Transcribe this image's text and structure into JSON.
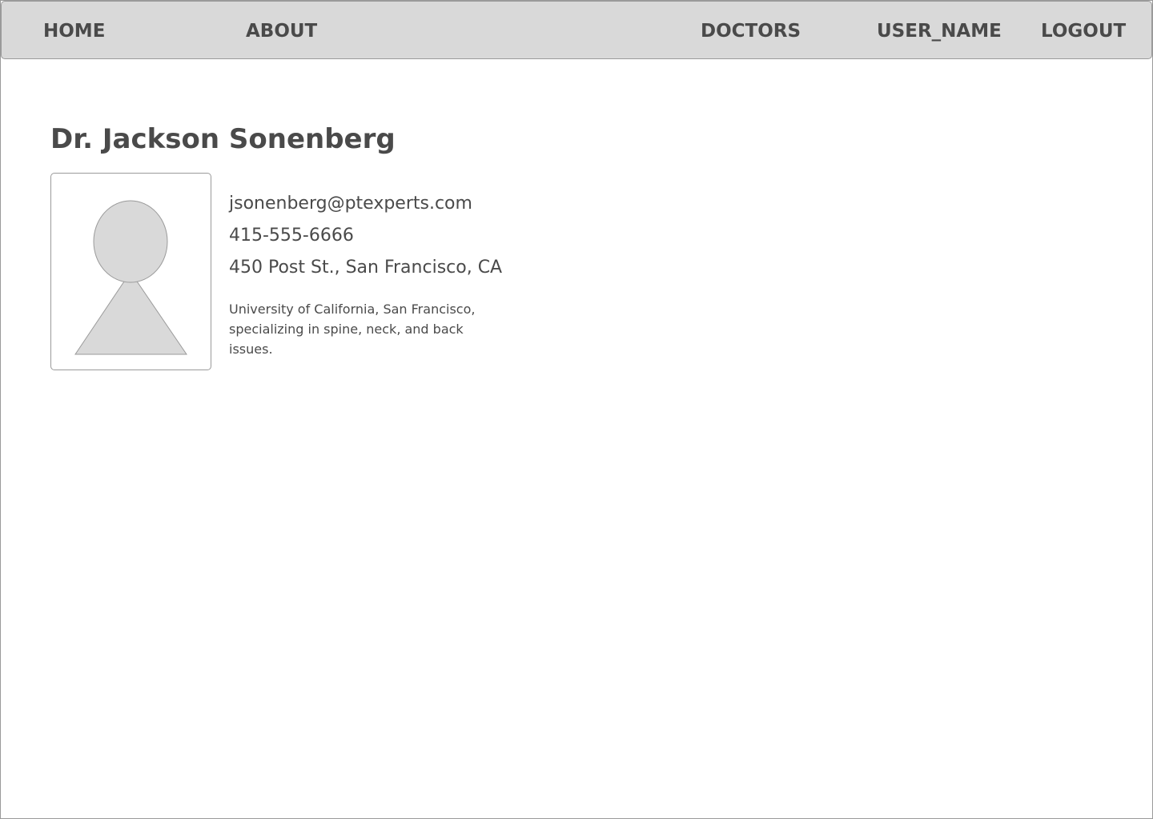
{
  "nav": {
    "home": "HOME",
    "about": "ABOUT",
    "doctors": "DOCTORS",
    "user": "USER_NAME",
    "logout": "LOGOUT"
  },
  "doctor": {
    "name": "Dr. Jackson Sonenberg",
    "email": "jsonenberg@ptexperts.com",
    "phone": "415-555-6666",
    "address": "450 Post St., San Francisco, CA",
    "bio": "University of California, San Francisco, specializing in  spine, neck, and back issues."
  },
  "colors": {
    "navbar_bg": "#d9d9d9",
    "border": "#9a9a9a",
    "text": "#4a4a4a",
    "placeholder_fill": "#d9d9d9"
  },
  "icons": {
    "avatar": "person-placeholder-icon"
  }
}
